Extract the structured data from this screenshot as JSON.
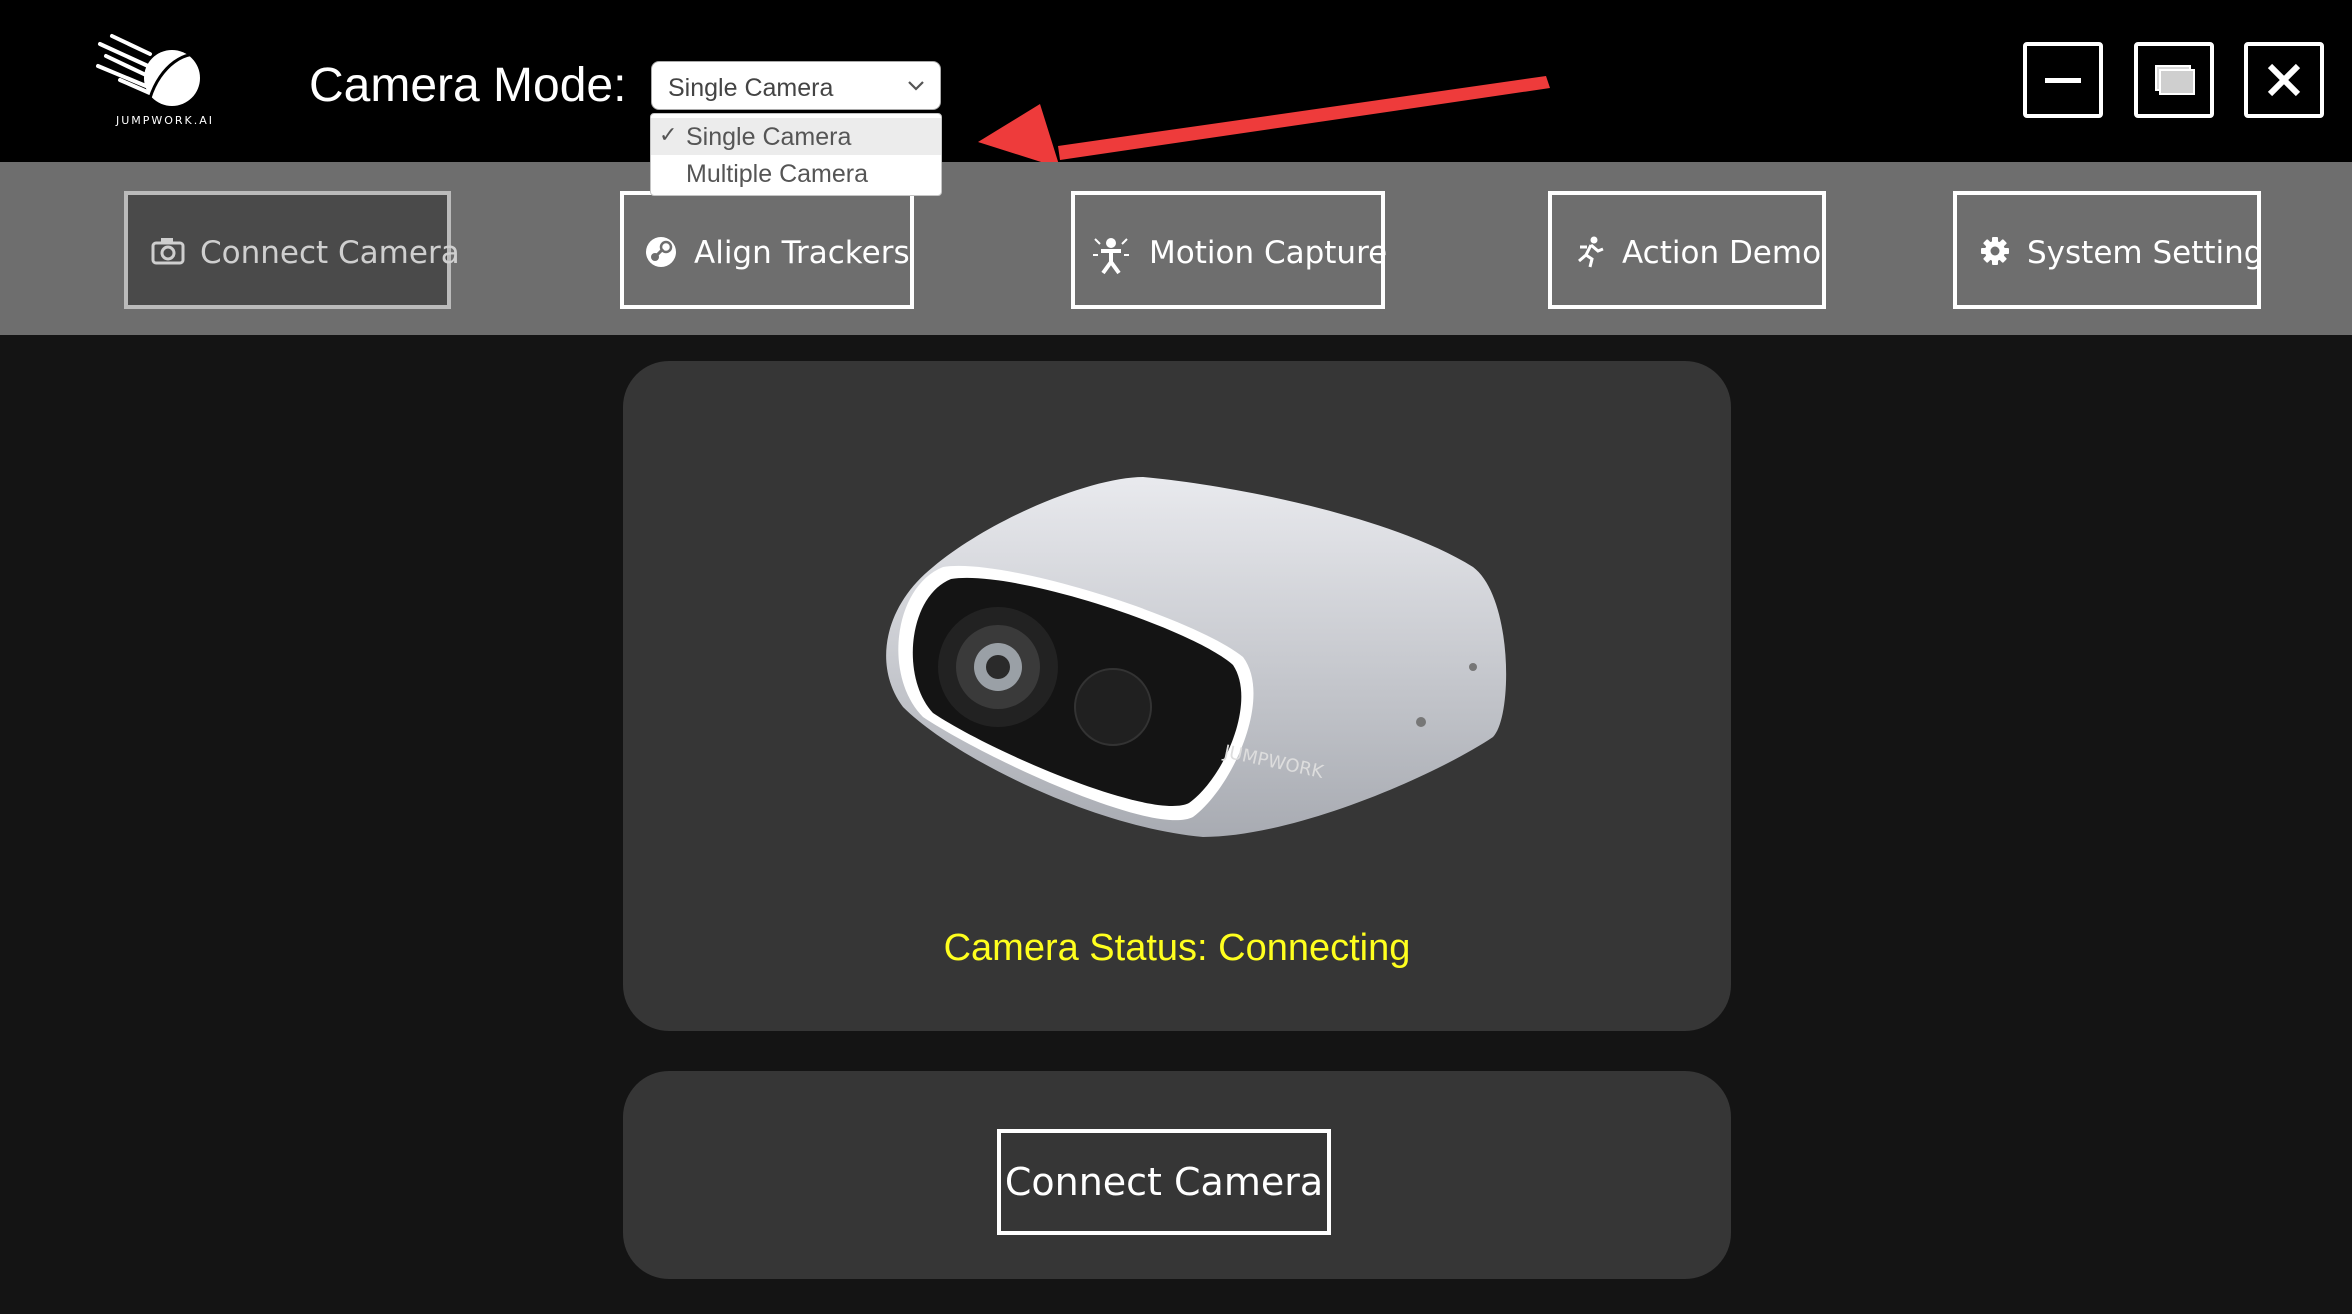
{
  "brand": {
    "logo_text": "JUMPWORK.AI"
  },
  "camera_mode": {
    "label": "Camera Mode:",
    "selected": "Single Camera",
    "options": [
      {
        "label": "Single Camera",
        "checked": true
      },
      {
        "label": "Multiple Camera",
        "checked": false
      }
    ]
  },
  "window_controls": {
    "minimize": "minimize-icon",
    "maximize": "maximize-icon",
    "close": "close-icon"
  },
  "toolbar": {
    "items": [
      {
        "label": "Connect Camera",
        "icon": "camera-icon",
        "enabled": false
      },
      {
        "label": "Align Trackers",
        "icon": "steam-icon",
        "enabled": true
      },
      {
        "label": "Motion Capture",
        "icon": "person-icon",
        "enabled": true
      },
      {
        "label": "Action Demo",
        "icon": "running-icon",
        "enabled": true
      },
      {
        "label": "System Setting",
        "icon": "gear-icon",
        "enabled": true
      }
    ]
  },
  "camera_panel": {
    "device_brand": "JUMPWORK",
    "status_text": "Camera Status: Connecting",
    "status_color": "#ffff1e"
  },
  "action_panel": {
    "connect_label": "Connect Camera"
  },
  "annotation": {
    "arrow_color": "#ee3b3b"
  }
}
